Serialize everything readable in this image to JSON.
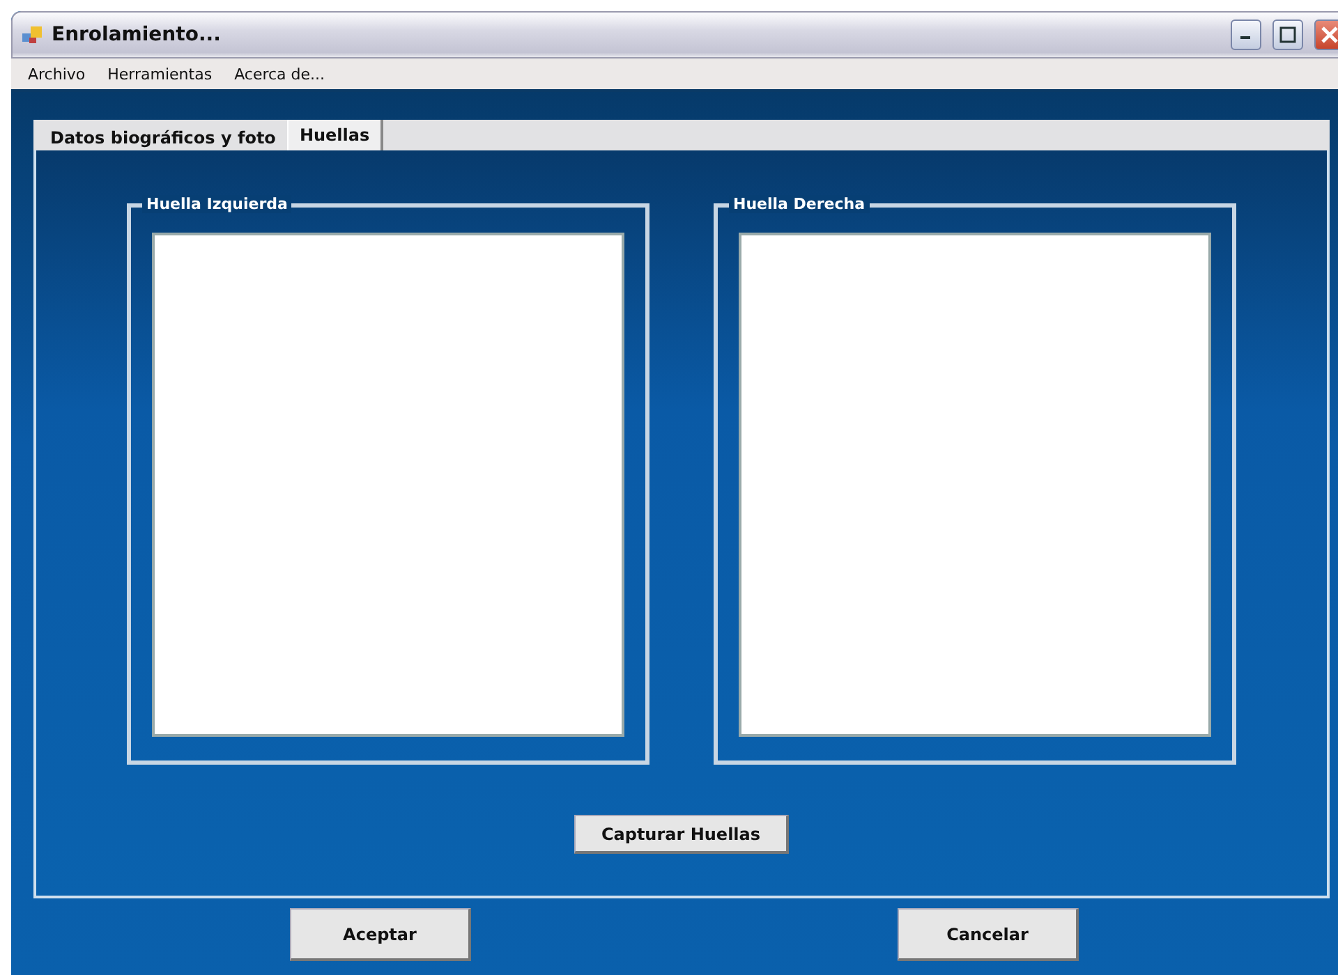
{
  "window": {
    "title": "Enrolamiento..."
  },
  "menu": [
    "Archivo",
    "Herramientas",
    "Acerca de..."
  ],
  "tabs": [
    {
      "label": "Datos biográficos y foto",
      "selected": false
    },
    {
      "label": "Huellas",
      "selected": true
    }
  ],
  "groups": [
    {
      "title": "Huella Izquierda"
    },
    {
      "title": "Huella Derecha"
    }
  ],
  "capture_button": "Capturar Huellas",
  "buttons": [
    "Aceptar",
    "Cancelar"
  ]
}
